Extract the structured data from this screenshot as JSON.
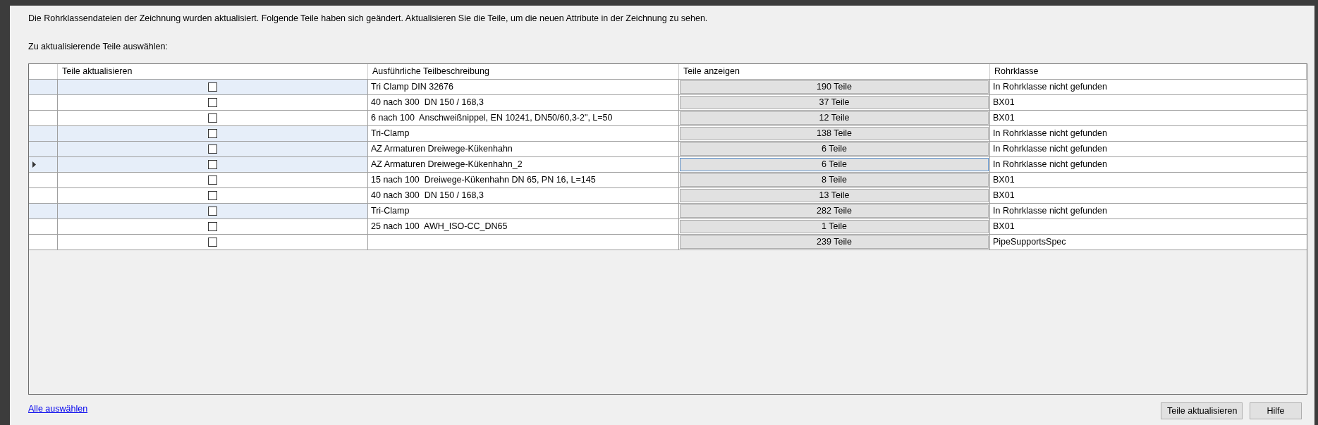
{
  "message": "Die Rohrklassendateien der Zeichnung wurden aktualisiert. Folgende Teile haben sich geändert. Aktualisieren Sie die Teile, um die neuen Attribute in der Zeichnung zu sehen.",
  "select_label": "Zu aktualisierende Teile auswählen:",
  "table": {
    "columns": [
      "Teile aktualisieren",
      "Ausführliche Teilbeschreibung",
      "Teile anzeigen",
      "Rohrklasse"
    ],
    "rows": [
      {
        "checked": false,
        "highlighted": true,
        "current": false,
        "description": "Tri Clamp DIN 32676",
        "show_parts": "190 Teile",
        "focused": false,
        "pipe_class": "In Rohrklasse nicht gefunden"
      },
      {
        "checked": false,
        "highlighted": false,
        "current": false,
        "description": "40 nach 300  DN 150 / 168,3",
        "show_parts": "37 Teile",
        "focused": false,
        "pipe_class": "BX01"
      },
      {
        "checked": false,
        "highlighted": false,
        "current": false,
        "description": "6 nach 100  Anschweißnippel, EN 10241, DN50/60,3-2\", L=50",
        "show_parts": "12 Teile",
        "focused": false,
        "pipe_class": "BX01"
      },
      {
        "checked": false,
        "highlighted": true,
        "current": false,
        "description": "Tri-Clamp",
        "show_parts": "138 Teile",
        "focused": false,
        "pipe_class": "In Rohrklasse nicht gefunden"
      },
      {
        "checked": false,
        "highlighted": true,
        "current": false,
        "description": "AZ Armaturen Dreiwege-Kükenhahn",
        "show_parts": "6 Teile",
        "focused": false,
        "pipe_class": "In Rohrklasse nicht gefunden"
      },
      {
        "checked": false,
        "highlighted": true,
        "current": true,
        "description": "AZ Armaturen Dreiwege-Kükenhahn_2",
        "show_parts": "6 Teile",
        "focused": true,
        "pipe_class": "In Rohrklasse nicht gefunden"
      },
      {
        "checked": false,
        "highlighted": false,
        "current": false,
        "description": "15 nach 100  Dreiwege-Kükenhahn DN 65, PN 16, L=145",
        "show_parts": "8 Teile",
        "focused": false,
        "pipe_class": "BX01"
      },
      {
        "checked": false,
        "highlighted": false,
        "current": false,
        "description": "40 nach 300  DN 150 / 168,3",
        "show_parts": "13 Teile",
        "focused": false,
        "pipe_class": "BX01"
      },
      {
        "checked": false,
        "highlighted": true,
        "current": false,
        "description": "Tri-Clamp",
        "show_parts": "282 Teile",
        "focused": false,
        "pipe_class": "In Rohrklasse nicht gefunden"
      },
      {
        "checked": false,
        "highlighted": false,
        "current": false,
        "description": "25 nach 100  AWH_ISO-CC_DN65",
        "show_parts": "1 Teile",
        "focused": false,
        "pipe_class": "BX01"
      },
      {
        "checked": false,
        "highlighted": false,
        "current": false,
        "description": "",
        "show_parts": "239 Teile",
        "focused": false,
        "pipe_class": "PipeSupportsSpec"
      }
    ]
  },
  "select_all_link": "Alle auswählen",
  "buttons": [
    "Teile aktualisieren",
    "Hilfe"
  ]
}
